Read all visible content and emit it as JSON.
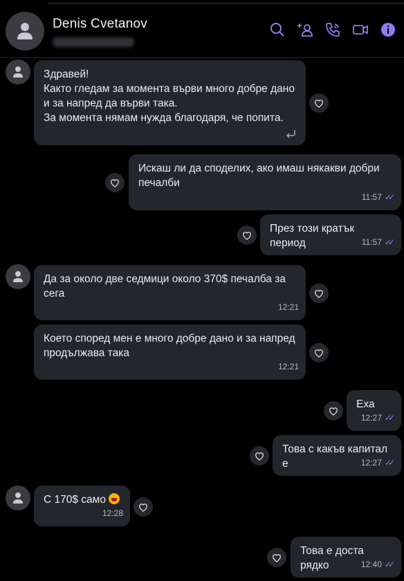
{
  "header": {
    "contact_name": "Denis Cvetanov"
  },
  "messages": [
    {
      "text": "Здравей!\nКакто гледам за момента върви много добре дано\nи за напред да върви така.\nЗа момента нямам нужда благодаря, че попита.",
      "time": ""
    },
    {
      "text": "Искаш ли да споделих, ако имаш някакви добри\nпечалби",
      "time": "11:57"
    },
    {
      "text": "През този кратък период",
      "time": "11:57"
    },
    {
      "text": "Да за около две седмици около 370$ печалба за\nсега",
      "time": "12:21"
    },
    {
      "text": "Което според мен е много добре дано и за напред\nпродължава така",
      "time": "12:21"
    },
    {
      "text": "Еха",
      "time": "12:27"
    },
    {
      "text": "Това с какъв капитал е",
      "time": "12:27"
    },
    {
      "text": "С 170$ само",
      "time": "12:28"
    },
    {
      "text": "Това е доста рядко",
      "time": "12:40"
    }
  ],
  "colors": {
    "accent": "#8f7cf0",
    "bubble": "#24262d",
    "background": "#000000"
  }
}
